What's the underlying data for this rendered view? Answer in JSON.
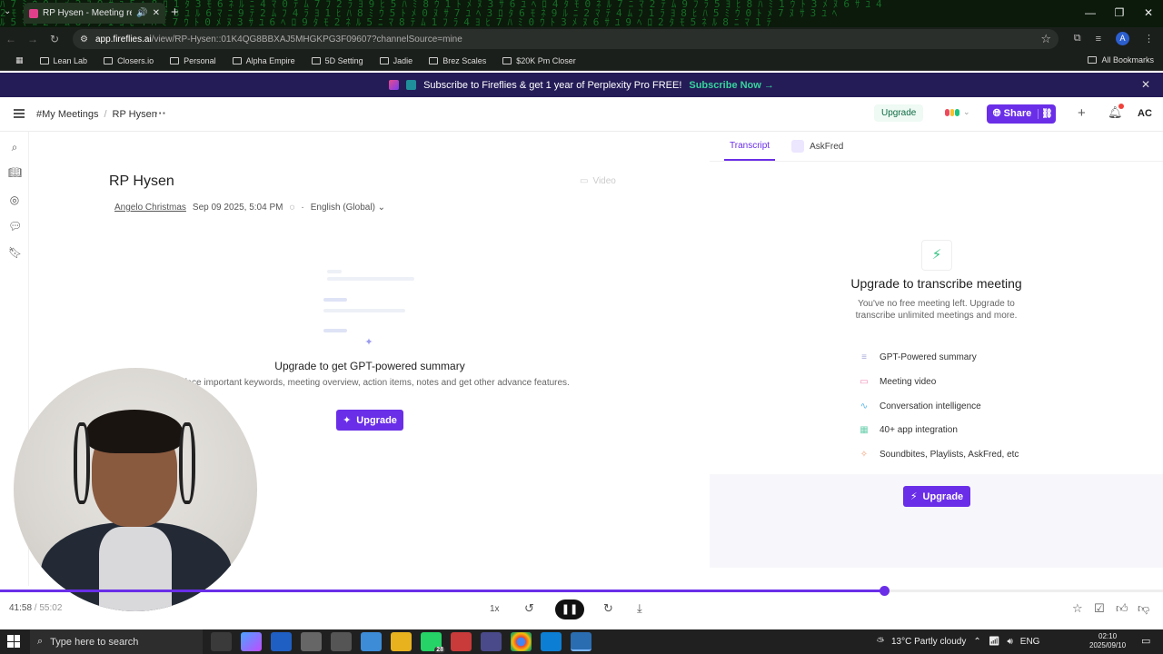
{
  "browser": {
    "tab_title": "RP Hysen - Meeting record",
    "url_domain": "app.fireflies.ai",
    "url_path": "/view/RP-Hysen::01K4QG8BBXAJ5MHGKPG3F09607?channelSource=mine",
    "bookmarks": [
      "Lean Lab",
      "Closers.io",
      "Personal",
      "Alpha Empire",
      "5D Setting",
      "Jadie",
      "Brez Scales",
      "$20K Pm Closer"
    ],
    "all_bookmarks": "All Bookmarks",
    "profile_initial": "A"
  },
  "banner": {
    "text": "Subscribe to Fireflies & get 1 year of Perplexity Pro FREE!",
    "cta": "Subscribe Now →"
  },
  "header": {
    "breadcrumb_root": "#My Meetings",
    "breadcrumb_current": "RP Hysen",
    "upgrade": "Upgrade",
    "share": "Share",
    "user_initials": "AC"
  },
  "meeting": {
    "title": "RP Hysen",
    "host": "Angelo Christmas",
    "datetime": "Sep 09 2025, 5:04 PM",
    "language": "English (Global)",
    "video_label": "Video"
  },
  "summary": {
    "title": "Upgrade to get GPT-powered summary",
    "subtitle": "Surface important keywords, meeting overview, action items, notes and get other advance features.",
    "button": "Upgrade"
  },
  "panel": {
    "tab_transcript": "Transcript",
    "tab_askfred": "AskFred",
    "title": "Upgrade to transcribe meeting",
    "subtitle_line1": "You've no free meeting left. Upgrade to",
    "subtitle_line2": "transcribe unlimited meetings and more.",
    "features": [
      "GPT-Powered summary",
      "Meeting video",
      "Conversation intelligence",
      "40+ app integration",
      "Soundbites, Playlists, AskFred, etc"
    ],
    "button": "Upgrade"
  },
  "player": {
    "current": "41:58",
    "total": "55:02",
    "speed": "1x",
    "progress": 0.76
  },
  "taskbar": {
    "search_placeholder": "Type here to search",
    "whatsapp_badge": "28",
    "weather": "13°C  Partly cloudy",
    "lang": "ENG",
    "time": "02:10",
    "date": "2025/09/10"
  },
  "colors": {
    "accent": "#6a2ee8",
    "banner_bg": "#241c57",
    "banner_cta": "#37d49d"
  }
}
